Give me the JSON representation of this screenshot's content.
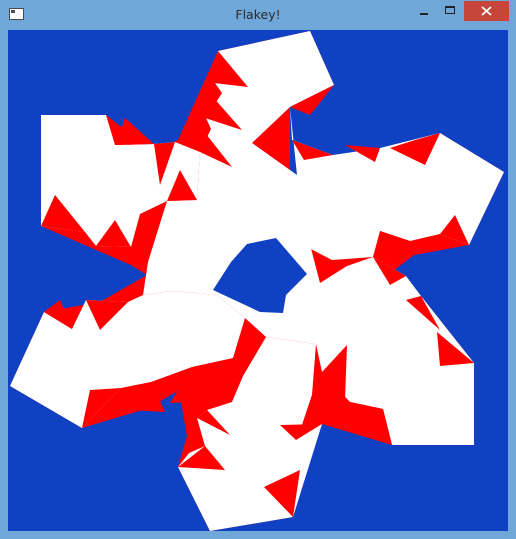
{
  "window": {
    "title": "Flakey!",
    "controls": {
      "minimize": "minimize",
      "maximize": "maximize",
      "close": "close"
    }
  },
  "canvas": {
    "background_color": "#0f41c2",
    "flake_color": "#ffffff",
    "accent_color": "#ff0000",
    "shape": "six-armed snowflake with red sawtooth edges"
  },
  "colors": {
    "titlebar": "#6fa7d9",
    "close_button": "#c7463a"
  }
}
